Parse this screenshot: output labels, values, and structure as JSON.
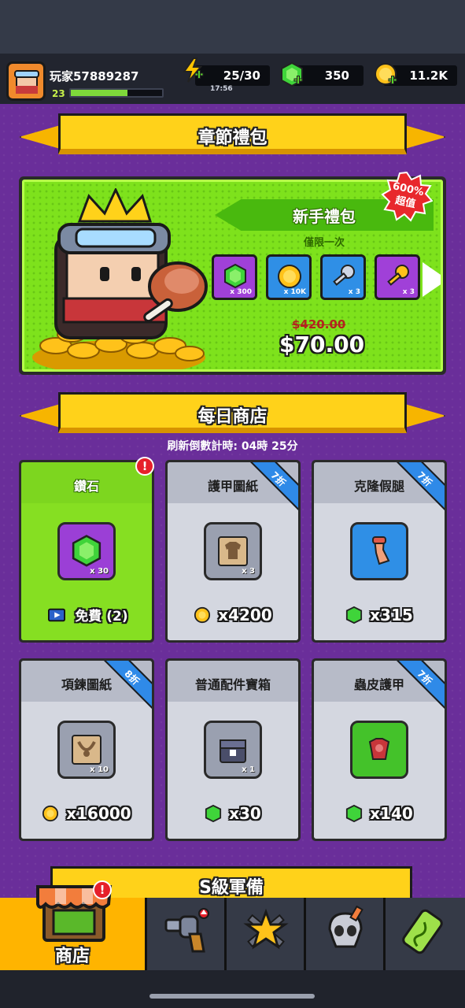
{
  "player": {
    "name": "玩家57889287",
    "level": "23",
    "xp_fraction": 0.62
  },
  "resources": {
    "energy": "25/30",
    "energy_timer": "17:56",
    "gems": "350",
    "coins": "11.2K"
  },
  "chapter_pack": {
    "banner": "章節禮包",
    "pack_title": "新手禮包",
    "limit": "僅限一次",
    "badge_line1": "600%",
    "badge_line2": "超值",
    "items": [
      {
        "icon": "gem-icon",
        "qty": "x 300",
        "color": "purple"
      },
      {
        "icon": "coin-icon",
        "qty": "x 10K",
        "color": "blue"
      },
      {
        "icon": "silver-key-icon",
        "qty": "x 3",
        "color": "blue"
      },
      {
        "icon": "gold-key-icon",
        "qty": "x 3",
        "color": "purple"
      }
    ],
    "old_price": "$420.00",
    "new_price": "$70.00"
  },
  "daily_shop": {
    "banner": "每日商店",
    "countdown": "刷新倒數計時:  04時 25分",
    "items": [
      {
        "title": "鑽石",
        "qty": "x 30",
        "price": "免費 (2)",
        "currency": "ad-icon",
        "discount": "",
        "alert": "!"
      },
      {
        "title": "護甲圖紙",
        "qty": "x 3",
        "price": "x4200",
        "currency": "coin-icon",
        "discount": "7折"
      },
      {
        "title": "克隆假腿",
        "qty": "",
        "price": "x315",
        "currency": "gem-icon",
        "discount": "7折"
      },
      {
        "title": "項鍊圖紙",
        "qty": "x 10",
        "price": "x16000",
        "currency": "coin-icon",
        "discount": "8折"
      },
      {
        "title": "普通配件寶箱",
        "qty": "x 1",
        "price": "x30",
        "currency": "gem-icon",
        "discount": ""
      },
      {
        "title": "蟲皮護甲",
        "qty": "",
        "price": "x140",
        "currency": "gem-icon",
        "discount": "7折"
      }
    ]
  },
  "s_grade": {
    "title": "S級軍備"
  },
  "nav": {
    "shop_label": "商店",
    "shop_alert": "!"
  },
  "colors": {
    "purple_bg": "#6a2e9a",
    "gold": "#ffd21a",
    "green": "#7ee21c",
    "accent_blue": "#2f8ae8"
  }
}
